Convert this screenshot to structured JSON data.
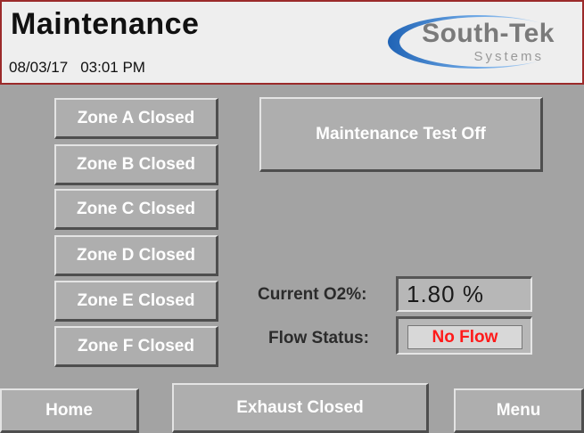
{
  "header": {
    "title": "Maintenance",
    "date": "08/03/17",
    "time": "03:01 PM",
    "border_color": "#9b2a2a"
  },
  "logo": {
    "name": "South-Tek",
    "subtitle": "Systems",
    "swoosh_color": "#4a8fd4"
  },
  "zones": [
    {
      "label": "Zone A Closed"
    },
    {
      "label": "Zone B Closed"
    },
    {
      "label": "Zone C Closed"
    },
    {
      "label": "Zone D Closed"
    },
    {
      "label": "Zone E Closed"
    },
    {
      "label": "Zone F Closed"
    }
  ],
  "maintenance_test": {
    "label": "Maintenance Test Off"
  },
  "status": {
    "current_o2_label": "Current O2%:",
    "current_o2_value": "1.80 %",
    "flow_status_label": "Flow Status:",
    "flow_status_value": "No Flow",
    "flow_status_color": "#ff1a1a"
  },
  "footer": {
    "home_label": "Home",
    "exhaust_label": "Exhaust Closed",
    "menu_label": "Menu"
  }
}
